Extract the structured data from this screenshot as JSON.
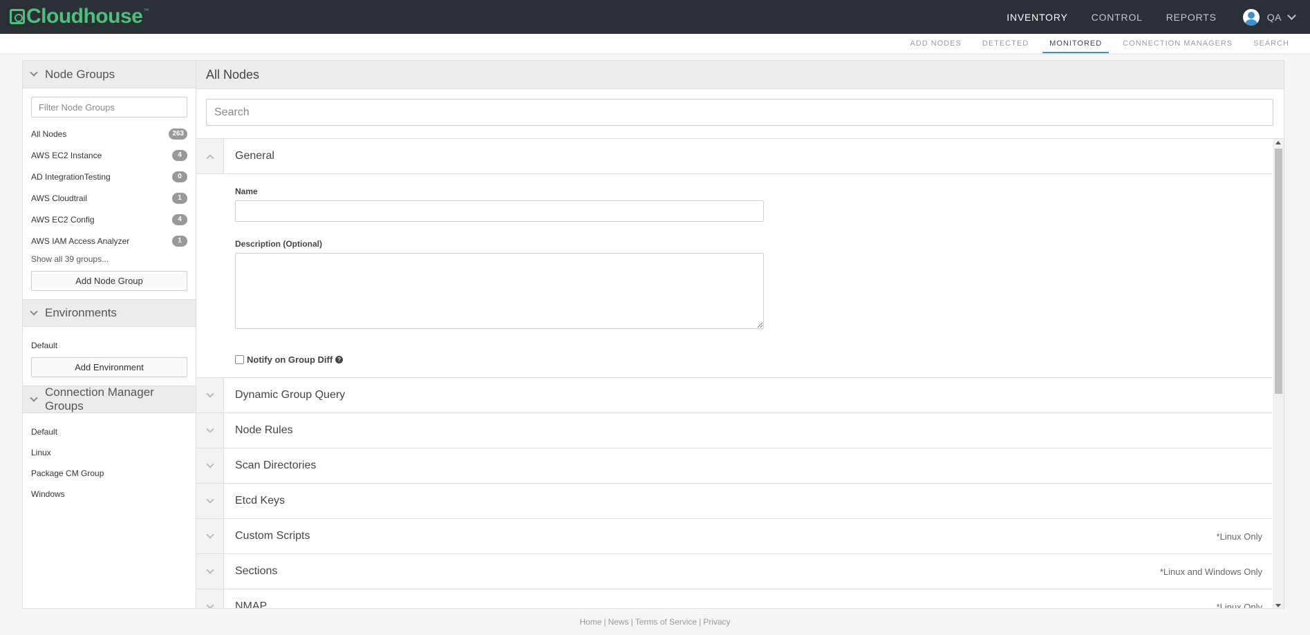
{
  "app": {
    "logo_text": "Cloudhouse",
    "logo_tm": "™",
    "brand_color": "#4cc17a"
  },
  "main_nav": {
    "items": [
      {
        "label": "INVENTORY",
        "active": true
      },
      {
        "label": "CONTROL",
        "active": false
      },
      {
        "label": "REPORTS",
        "active": false
      }
    ],
    "user_name": "QA"
  },
  "sub_nav": {
    "items": [
      {
        "label": "ADD NODES",
        "active": false
      },
      {
        "label": "DETECTED",
        "active": false
      },
      {
        "label": "MONITORED",
        "active": true
      },
      {
        "label": "CONNECTION MANAGERS",
        "active": false
      },
      {
        "label": "SEARCH",
        "active": false
      }
    ]
  },
  "sidebar": {
    "node_groups": {
      "title": "Node Groups",
      "filter_placeholder": "Filter Node Groups",
      "items": [
        {
          "label": "All Nodes",
          "count": "263"
        },
        {
          "label": "AWS EC2 Instance",
          "count": "4"
        },
        {
          "label": "AD IntegrationTesting",
          "count": "0"
        },
        {
          "label": "AWS Cloudtrail",
          "count": "1"
        },
        {
          "label": "AWS EC2 Config",
          "count": "4"
        },
        {
          "label": "AWS IAM Access Analyzer",
          "count": "1"
        }
      ],
      "show_all": "Show all 39 groups...",
      "add_button": "Add Node Group"
    },
    "environments": {
      "title": "Environments",
      "items": [
        "Default"
      ],
      "add_button": "Add Environment"
    },
    "connection_manager_groups": {
      "title": "Connection Manager Groups",
      "items": [
        "Default",
        "Linux",
        "Package CM Group",
        "Windows"
      ]
    }
  },
  "main": {
    "title": "All Nodes",
    "search_placeholder": "Search",
    "general": {
      "title": "General",
      "name_label": "Name",
      "name_value": "",
      "description_label": "Description (Optional)",
      "description_value": "",
      "notify_label": "Notify on Group Diff",
      "help_glyph": "?"
    },
    "sections": [
      {
        "title": "Dynamic Group Query",
        "note": ""
      },
      {
        "title": "Node Rules",
        "note": ""
      },
      {
        "title": "Scan Directories",
        "note": ""
      },
      {
        "title": "Etcd Keys",
        "note": ""
      },
      {
        "title": "Custom Scripts",
        "note": "*Linux Only"
      },
      {
        "title": "Sections",
        "note": "*Linux and Windows Only"
      },
      {
        "title": "NMAP",
        "note": "*Linux Only"
      }
    ]
  },
  "footer": {
    "links": [
      "Home",
      "News",
      "Terms of Service",
      "Privacy"
    ],
    "separator": "|"
  }
}
